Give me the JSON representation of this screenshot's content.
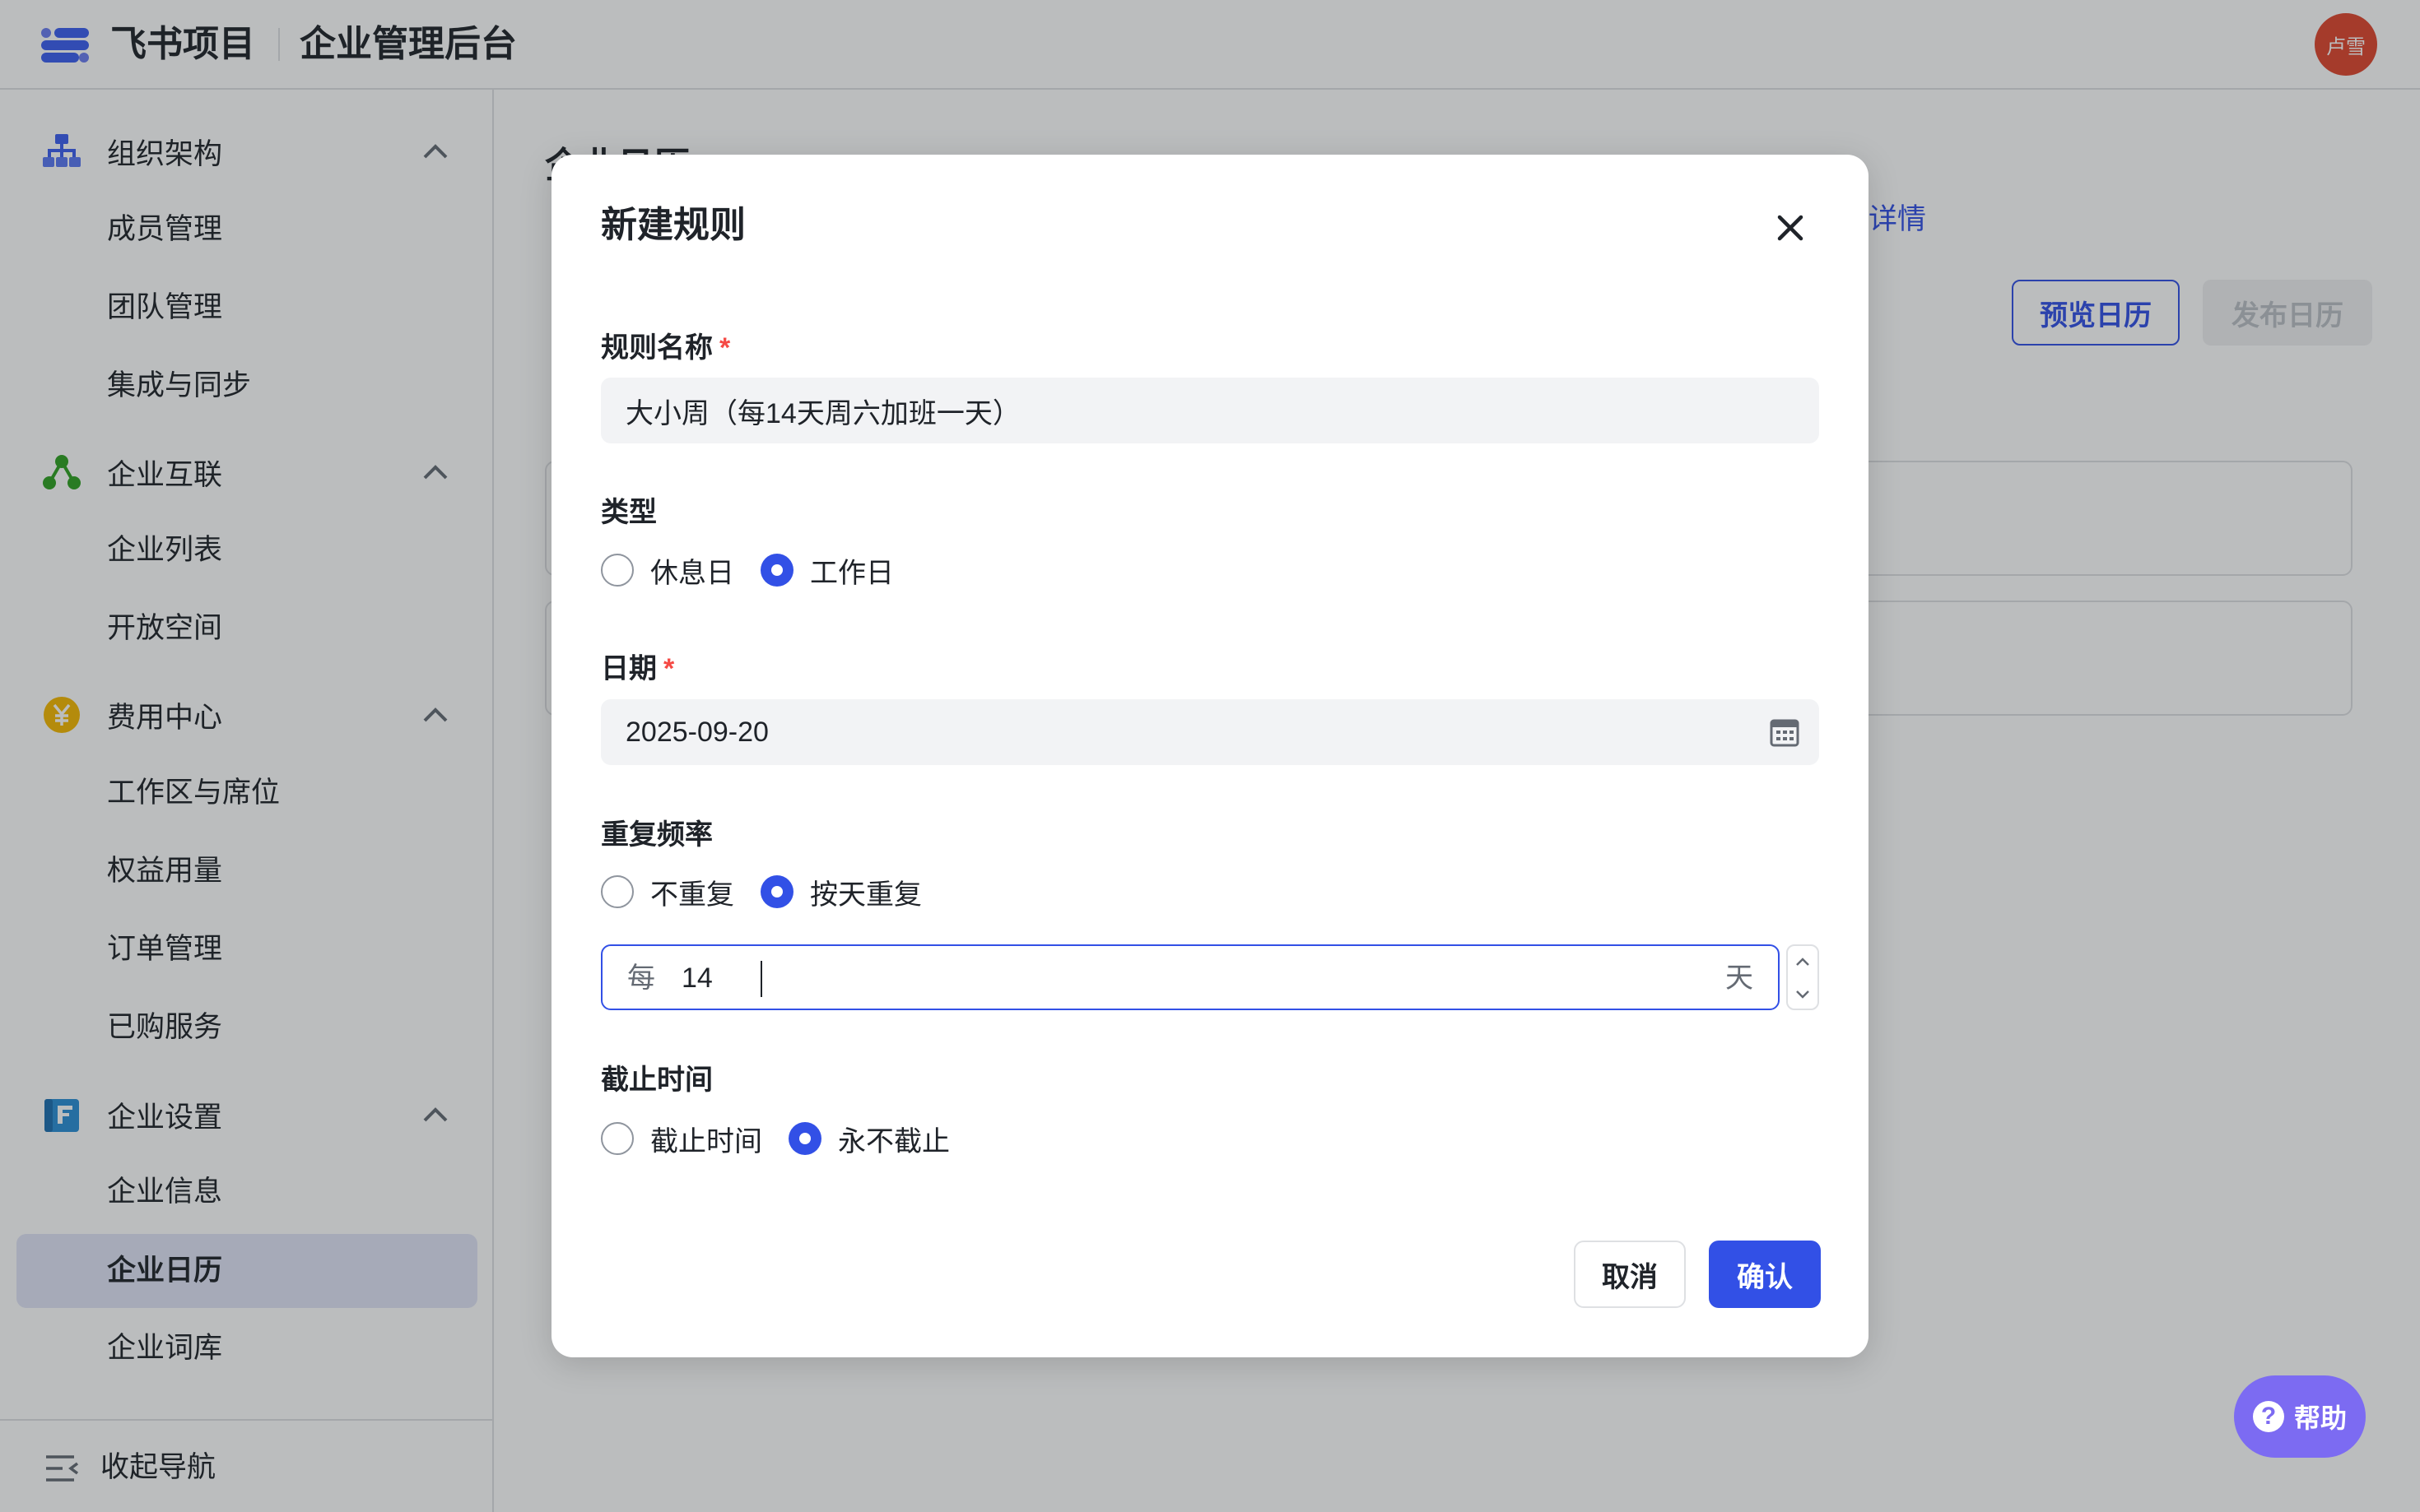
{
  "header": {
    "brand": "飞书项目",
    "console_title": "企业管理后台",
    "avatar_text": "卢雪"
  },
  "sidebar": {
    "groups": [
      {
        "label": "组织架构",
        "icon": "org-chart-icon",
        "items": [
          "成员管理",
          "团队管理",
          "集成与同步"
        ]
      },
      {
        "label": "企业互联",
        "icon": "network-icon",
        "items": [
          "企业列表",
          "开放空间"
        ]
      },
      {
        "label": "费用中心",
        "icon": "yuan-coin-icon",
        "items": [
          "工作区与席位",
          "权益用量",
          "订单管理",
          "已购服务"
        ]
      },
      {
        "label": "企业设置",
        "icon": "settings-doc-icon",
        "items": [
          "企业信息",
          "企业日历",
          "企业词库"
        ]
      }
    ],
    "active_item": "企业日历",
    "collapse_label": "收起导航"
  },
  "main": {
    "page_title": "企业日历",
    "detail_link": "详情",
    "preview_button": "预览日历",
    "publish_button": "发布日历"
  },
  "modal": {
    "title": "新建规则",
    "name_label": "规则名称",
    "name_value": "大小周（每14天周六加班一天）",
    "type_label": "类型",
    "type_options": [
      "休息日",
      "工作日"
    ],
    "type_selected": "工作日",
    "date_label": "日期",
    "date_value": "2025-09-20",
    "repeat_label": "重复频率",
    "repeat_options": [
      "不重复",
      "按天重复"
    ],
    "repeat_selected": "按天重复",
    "interval_prefix": "每",
    "interval_value": "14",
    "interval_suffix": "天",
    "end_label": "截止时间",
    "end_options": [
      "截止时间",
      "永不截止"
    ],
    "end_selected": "永不截止",
    "cancel_button": "取消",
    "confirm_button": "确认",
    "required_mark": "*"
  },
  "help": {
    "label": "帮助",
    "icon": "question-icon"
  },
  "colors": {
    "primary": "#3250e6",
    "required": "#f54a45",
    "help_bg": "#7c6bf2",
    "avatar_bg": "#e0452d",
    "active_nav_bg": "#e1e4f7"
  }
}
